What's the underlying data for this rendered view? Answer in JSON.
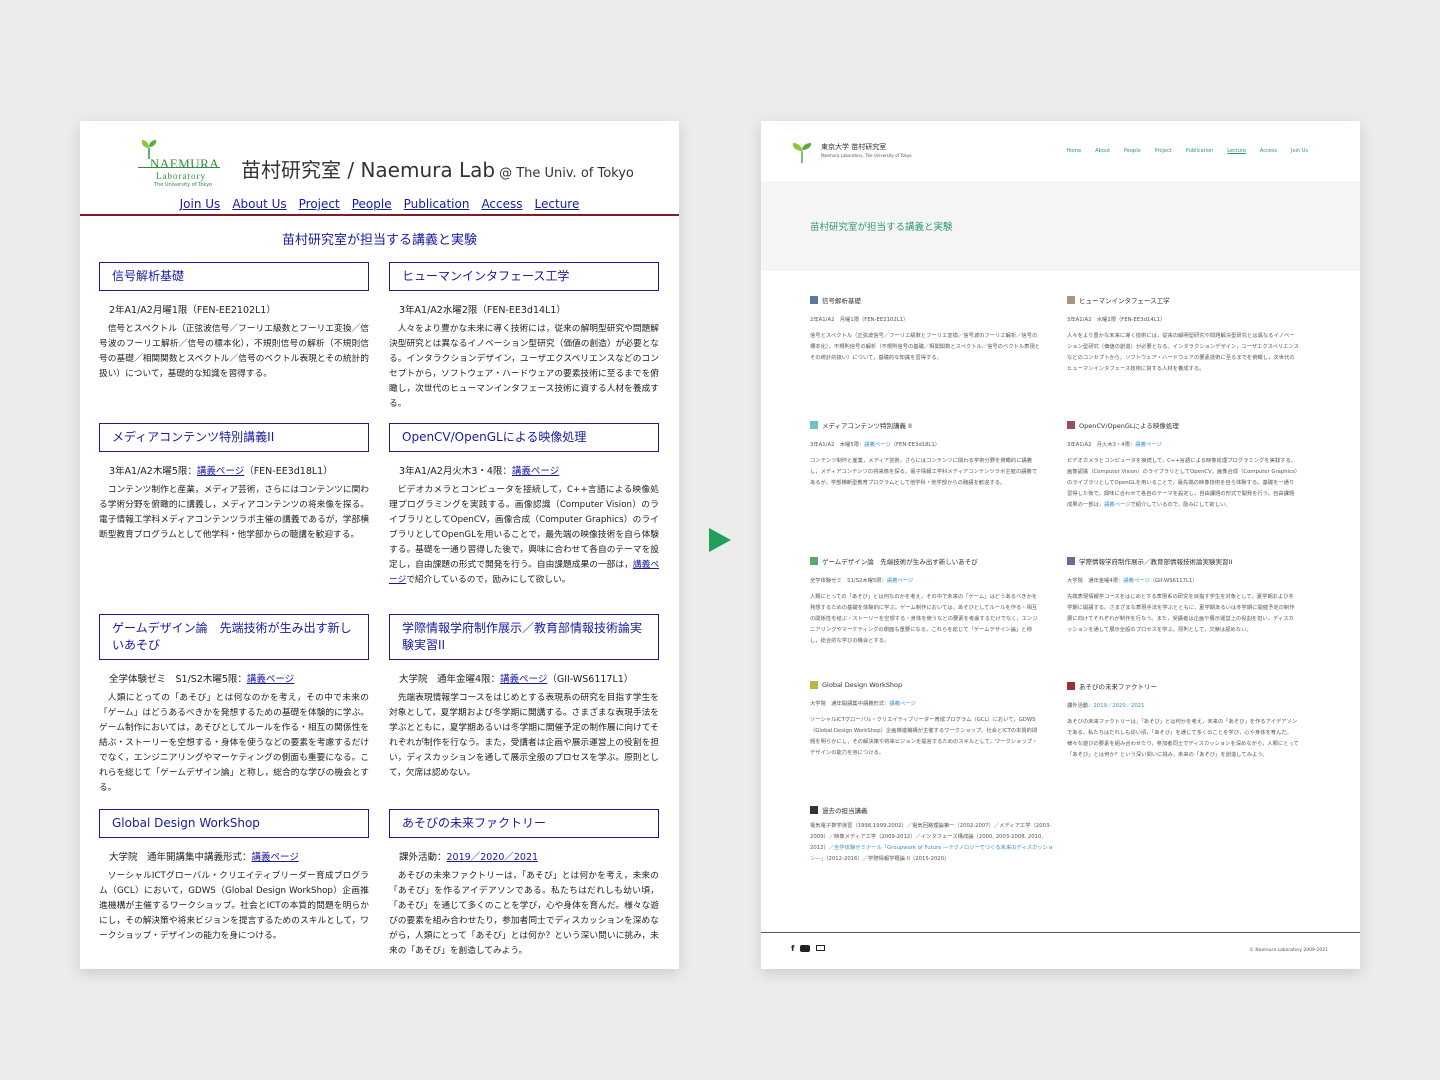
{
  "old": {
    "logo": {
      "name": "NAEMURA",
      "sub": "Laboratory",
      "univ": "The University of Tokyo"
    },
    "title": "苗村研究室 / Naemura Lab",
    "title_at": "@ The Univ. of Tokyo",
    "nav": [
      "Join Us",
      "About Us",
      "Project",
      "People",
      "Publication",
      "Access",
      "Lecture"
    ],
    "heading": "苗村研究室が担当する講義と実験",
    "courses": [
      {
        "title": "信号解析基礎",
        "meta": "2年A1/A2月曜1限（FEN-EE2102L1）",
        "desc": "信号とスペクトル（正弦波信号／フーリエ級数とフーリエ変換／信号波のフーリエ解析／信号の標本化），不規則信号の解析（不規則信号の基礎／相関関数とスペクトル／信号のベクトル表現とその統計的扱い）について，基礎的な知識を習得する。"
      },
      {
        "title": "ヒューマンインタフェース工学",
        "meta": "3年A1/A2水曜2限（FEN-EE3d14L1）",
        "desc": "人々をより豊かな未来に導く技術には，従来の解明型研究や問題解決型研究とは異なるイノベーション型研究（価値の創造）が必要となる。インタラクションデザイン，ユーザエクスペリエンスなどのコンセプトから，ソフトウェア・ハードウェアの要素技術に至るまでを俯瞰し，次世代のヒューマンインタフェース技術に資する人材を養成する。"
      },
      {
        "title": "メディアコンテンツ特別講義II",
        "meta_pre": "3年A1/A2木曜5限：",
        "meta_link": "講義ページ",
        "meta_post": "（FEN-EE3d18L1）",
        "desc": "コンテンツ制作と産業，メディア芸術，さらにはコンテンツに関わる学術分野を俯瞰的に講義し，メディアコンテンツの将来像を探る。電子情報工学科メディアコンテンツラボ主催の講義であるが，学部横断型教育プログラムとして他学科・他学部からの聴講を歓迎する。"
      },
      {
        "title": "OpenCV/OpenGLによる映像処理",
        "meta_pre": "3年A1/A2月火木3・4限：",
        "meta_link": "講義ページ",
        "desc": "ビデオカメラとコンピュータを接続して，C++言語による映像処理プログラミングを実践する。画像認識（Computer Vision）のライブラリとしてOpenCV，画像合成（Computer Graphics）のライブラリとしてOpenGLを用いることで，最先端の映像技術を自ら体験する。基礎を一通り習得した後で，興味に合わせて各自のテーマを設定し，自由課題の形式で開発を行う。自由課題成果の一部は，",
        "desc_link": "講義ページ",
        "desc_post": "で紹介しているので，励みにして欲しい。"
      },
      {
        "title": "ゲームデザイン論　先端技術が生み出す新しいあそび",
        "meta_pre": "全学体験ゼミ　S1/S2木曜5限：",
        "meta_link": "講義ページ",
        "desc": "人類にとっての「あそび」とは何なのかを考え，その中で未来の「ゲーム」はどうあるべきかを発想するための基礎を体験的に学ぶ。ゲーム制作においては，あそびとしてルールを作る・相互の関係性を結ぶ・ストーリーを空想する・身体を使うなどの要素を考慮するだけでなく，エンジニアリングやマーケティングの側面も重要になる。これらを総じて「ゲームデザイン論」と称し，総合的な学びの機会とする。"
      },
      {
        "title": "学際情報学府制作展示／教育部情報技術論実験実習II",
        "meta_pre": "大学院　通年金曜4限：",
        "meta_link": "講義ページ",
        "meta_post": "（GII-WS6117L1）",
        "desc": "先端表現情報学コースをはじめとする表現系の研究を目指す学生を対象として，夏学期および冬学期に開講する。さまざまな表現手法を学ぶとともに，夏学期あるいは冬学期に開催予定の制作展に向けてそれぞれが制作を行なう。また，受講者は企画や展示運営上の役割を担い，ディスカッションを通して展示全般のプロセスを学ぶ。原則として，欠席は認めない。"
      },
      {
        "title": "Global Design WorkShop",
        "meta_pre": "大学院　通年開講集中講義形式：",
        "meta_link": "講義ページ",
        "desc": "ソーシャルICTグローバル・クリエイティブリーダー育成プログラム（GCL）において，GDWS（Global Design WorkShop）企画推進機構が主催するワークショップ。社会とICTの本質的問題を明らかにし，その解決策や将来ビジョンを提言するためのスキルとして，ワークショップ・デザインの能力を身につける。"
      },
      {
        "title": "あそびの未来ファクトリー",
        "meta_pre": "課外活動：",
        "meta_link": "2019／2020／2021",
        "desc": "あそびの未来ファクトリーは，「あそび」とは何かを考え，未来の「あそび」を作るアイデアソンである。私たちはだれしも幼い頃，「あそび」を通じて多くのことを学び，心や身体を育んだ。様々な遊びの要素を組み合わせたり，参加者同士でディスカッションを深めながら，人類にとって「あそび」とは何か？という深い問いに挑み，未来の「あそび」を創造してみよう。"
      }
    ]
  },
  "new": {
    "logo_title": "東京大学 苗村研究室",
    "logo_sub": "Naemura Laboratory, The University of Tokyo",
    "nav": [
      "Home",
      "About",
      "People",
      "Project",
      "Publication",
      "Lecture",
      "Access",
      "Join Us"
    ],
    "current_nav": "Lecture",
    "heading": "苗村研究室が担当する講義と実験",
    "courses": [
      {
        "title": "信号解析基礎",
        "color": "#5a7a9a",
        "meta": "2年A1/A2　月曜1限（FEN-EE2102L1）",
        "desc": "信号とスペクトル（正弦波信号／フーリエ級数とフーリエ変換／信号波のフーリエ解析／信号の標本化），不規則信号の解析（不規則信号の基礎／相関関数とスペクトル／信号のベクトル表現とその統計的扱い）について，基礎的な知識を習得する。"
      },
      {
        "title": "ヒューマンインタフェース工学",
        "color": "#a89478",
        "meta": "3年A1/A2　水曜2限（FEN-EE3d14L1）",
        "desc": "人々をより豊かな未来に導く技術には，従来の解明型研究や問題解決型研究とは異なるイノベーション型研究（価値の創造）が必要となる。インタラクションデザイン，ユーザエクスペリエンスなどのコンセプトから，ソフトウェア・ハードウェアの要素技術に至るまでを俯瞰し，次世代のヒューマンインタフェース技術に資する人材を養成する。"
      },
      {
        "title": "メディアコンテンツ特別講義 II",
        "color": "#6fc0c7",
        "meta_pre": "3年A1/A2　木曜5限：",
        "meta_link": "講義ページ",
        "meta_post": "（FEN-EE3d18L1）",
        "desc": "コンテンツ制作と産業，メディア芸術，さらにはコンテンツに関わる学術分野を俯瞰的に講義し，メディアコンテンツの将来像を探る。電子情報工学科メディアコンテンツラボ主催の講義であるが，学部横断型教育プログラムとして他学科・他学部からの聴講を歓迎する。"
      },
      {
        "title": "OpenCV/OpenGLによる映像処理",
        "color": "#9a4f5f",
        "meta_pre": "3年A1/A2　月火木3・4限：",
        "meta_link": "講義ページ",
        "desc": "ビデオカメラとコンピュータを接続して，C++言語による映像処理プログラミングを実践する。画像認識（Computer Vision）のライブラリとしてOpenCV，画像合成（Computer Graphics）のライブラリとしてOpenGLを用いることで，最先端の映像技術を自ら体験する。基礎を一通り習得した後で，興味に合わせて各自のテーマを設定し，自由課題の形式で開発を行う。自由課題成果の一部は，",
        "desc_link": "講義ページ",
        "desc_post": "で紹介しているので，励みにして欲しい。"
      },
      {
        "title": "ゲームデザイン論　先端技術が生み出す新しいあそび",
        "color": "#5aa86a",
        "meta_pre": "全学体験ゼミ　S1/S2木曜5限：",
        "meta_link": "講義ページ",
        "desc": "人類にとっての「あそび」とは何なのかを考え，その中で未来の「ゲーム」はどうあるべきかを発想するための基礎を体験的に学ぶ。ゲーム制作においては，あそびとしてルールを作る・相互の関係性を結ぶ・ストーリーを空想する・身体を使うなどの要素を考慮するだけでなく，エンジニアリングやマーケティングの側面も重要になる。これらを総じて「ゲームデザイン論」と称し，総合的な学びの機会とする。"
      },
      {
        "title": "学際情報学府制作展示／教育部情報技術論実験実習II",
        "color": "#6a6a9a",
        "meta_pre": "大学院　通年金曜4限：",
        "meta_link": "講義ページ",
        "meta_post": "（GII-WS6117L1）",
        "desc": "先端表現情報学コースをはじめとする表現系の研究を目指す学生を対象として，夏学期および冬学期に開講する。さまざまな表現手法を学ぶとともに，夏学期あるいは冬学期に開催予定の制作展に向けてそれぞれが制作を行なう。また，受講者は企画や展示運営上の役割を担い，ディスカッションを通して展示全般のプロセスを学ぶ。原則として，欠席は認めない。"
      },
      {
        "title": "Global Design WorkShop",
        "color": "#b8b84a",
        "meta_pre": "大学院　通年開講集中講義形式：",
        "meta_link": "講義ページ",
        "desc": "ソーシャルICTグローバル・クリエイティブリーダー育成プログラム（GCL）において，GDWS（Global Design WorkShop）企画推進機構が主催するワークショップ。社会とICTの本質的問題を明らかにし，その解決策や将来ビジョンを提言するためのスキルとして，ワークショップ・デザインの能力を身につける。"
      },
      {
        "title": "あそびの未来ファクトリー",
        "color": "#a03030",
        "meta_pre": "課外活動：",
        "meta_link": "2019／2020／2021",
        "desc": "あそびの未来ファクトリーは，「あそび」とは何かを考え，未来の「あそび」を作るアイデアソンである。私たちはだれしも幼い頃，「あそび」を通じて多くのことを学び，心や身体を育んだ。様々な遊びの要素を組み合わせたり，参加者同士でディスカッションを深めながら，人類にとって「あそび」とは何か？という深い問いに挑み，未来の「あそび」を創造してみよう。"
      }
    ],
    "past": {
      "title": "過去の担当講義",
      "color": "#333333",
      "desc": "電気電子数学演習（1998,1999,2002）／電気回路理論第一（2002-2007）／メディア工学（2003-2009）／映像メディア工学（2009-2012）／インタフェース構成論（2000, 2003-2008, 2010, 2012）／",
      "link": "全学体験ゼミナール「Groupwork of Future ―テクノロジーでつくる未来のディスカッション―」",
      "post": "（2012-2016）／学際情報学概論 II（2015-2020）"
    },
    "footer_copy": "© Naemura Laboratory 2009-2021",
    "social": [
      "facebook-icon",
      "youtube-icon",
      "mail-icon"
    ],
    "accent": "#2e9a6a"
  }
}
